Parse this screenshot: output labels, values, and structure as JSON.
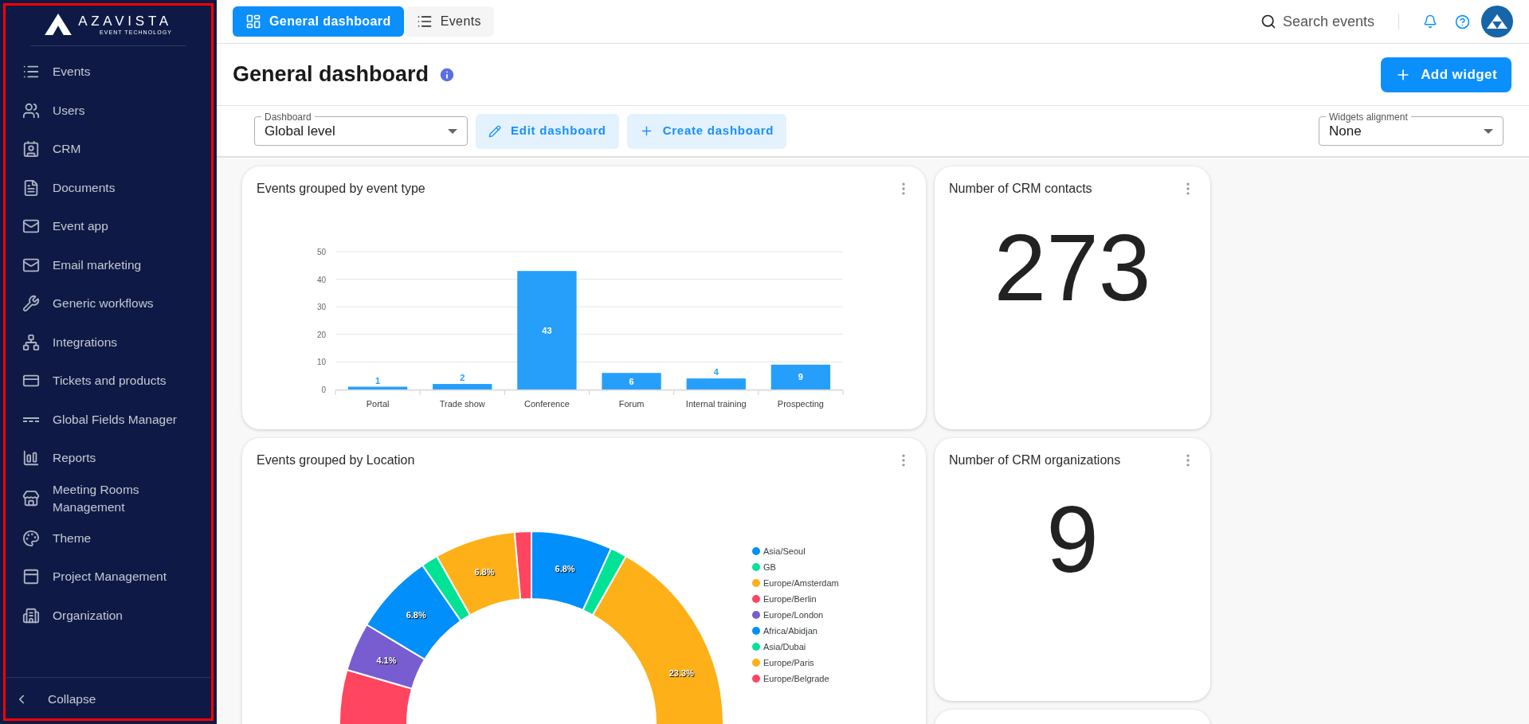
{
  "sidebar": {
    "logo": {
      "name": "AZAVISTA",
      "tagline": "EVENT TECHNOLOGY"
    },
    "items": [
      {
        "label": "Events"
      },
      {
        "label": "Users"
      },
      {
        "label": "CRM"
      },
      {
        "label": "Documents"
      },
      {
        "label": "Event app"
      },
      {
        "label": "Email marketing"
      },
      {
        "label": "Generic workflows"
      },
      {
        "label": "Integrations"
      },
      {
        "label": "Tickets and products"
      },
      {
        "label": "Global Fields Manager"
      },
      {
        "label": "Reports"
      },
      {
        "label": "Meeting Rooms Management"
      },
      {
        "label": "Theme"
      },
      {
        "label": "Project Management"
      },
      {
        "label": "Organization"
      }
    ],
    "collapse": "Collapse"
  },
  "top_tabs": [
    {
      "label": "General dashboard",
      "selected": true
    },
    {
      "label": "Events",
      "selected": false
    }
  ],
  "search": {
    "placeholder": "Search events"
  },
  "page": {
    "title": "General dashboard",
    "add_button": "Add widget"
  },
  "toolbar": {
    "dashboard_select": {
      "label": "Dashboard",
      "value": "Global level"
    },
    "buttons": [
      "Edit dashboard",
      "Create dashboard"
    ],
    "alignment_select": {
      "label": "Widgets alignment",
      "value": "None"
    }
  },
  "widgets": [
    {
      "kind": "chart",
      "title": "Events grouped by event type",
      "chart_data": {
        "type": "bar",
        "categories": [
          "Portal",
          "Trade show",
          "Conference",
          "Forum",
          "Internal training",
          "Prospecting"
        ],
        "series": [
          {
            "color": "#269ffb",
            "values": [
              1,
              2,
              43,
              6,
              4,
              9
            ]
          }
        ],
        "ylim": [
          0,
          50
        ],
        "yticks": [
          0,
          10,
          20,
          30,
          40,
          50
        ],
        "grid": true,
        "data_labels": true
      }
    },
    {
      "kind": "stat",
      "title": "Number of CRM contacts",
      "value": "273"
    },
    {
      "kind": "chart",
      "title": "Events grouped by Location",
      "chart_data": {
        "type": "donut",
        "values": [
          6.8,
          1.4,
          23.3,
          47.9,
          4.1,
          6.8,
          1.4,
          6.8,
          1.4
        ],
        "value_labels": [
          "6.8%",
          null,
          "23.3%",
          null,
          "4.1%",
          "6.8%",
          null,
          "6.8%",
          null
        ]
      },
      "legend": [
        {
          "label": "Asia/Seoul",
          "color": "#008ffb"
        },
        {
          "label": "GB",
          "color": "#00e396"
        },
        {
          "label": "Europe/Amsterdam",
          "color": "#feb019"
        },
        {
          "label": "Europe/Berlin",
          "color": "#ff4560"
        },
        {
          "label": "Europe/London",
          "color": "#775dd0"
        },
        {
          "label": "Africa/Abidjan",
          "color": "#008ffb"
        },
        {
          "label": "Asia/Dubai",
          "color": "#00e396"
        },
        {
          "label": "Europe/Paris",
          "color": "#feb019"
        },
        {
          "label": "Europe/Belgrade",
          "color": "#ff4560"
        }
      ]
    },
    {
      "kind": "stat",
      "title": "Number of CRM organizations",
      "value": "9"
    }
  ]
}
